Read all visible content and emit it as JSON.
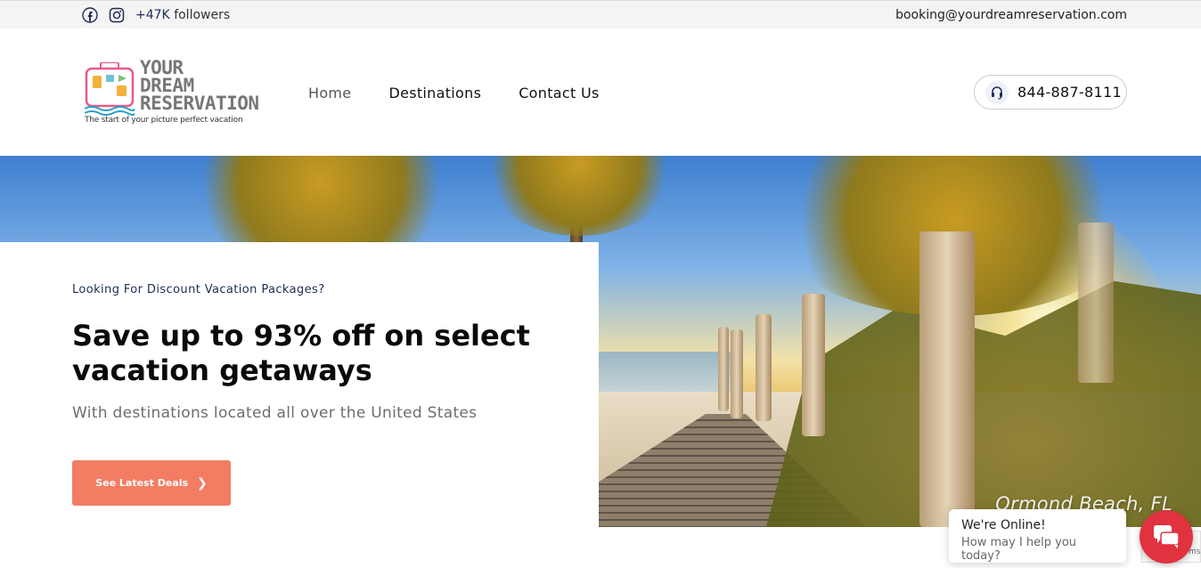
{
  "topbar": {
    "social_icons": [
      "facebook-icon",
      "instagram-icon"
    ],
    "followers_count": "+47K",
    "followers_label": "followers",
    "email": "booking@yourdreamreservation.com"
  },
  "header": {
    "logo": {
      "line1": "YOUR",
      "line2": "DREAM",
      "line3": "RESERVATION",
      "tagline": "The start of your picture perfect vacation"
    },
    "nav": [
      {
        "label": "Home",
        "active": true
      },
      {
        "label": "Destinations",
        "active": false
      },
      {
        "label": "Contact Us",
        "active": false
      }
    ],
    "phone": "844-887-8111"
  },
  "hero": {
    "eyebrow": "Looking For Discount Vacation Packages?",
    "headline": "Save up to 93% off on select vacation getaways",
    "subline": "With destinations located all over the United States",
    "cta_label": "See Latest Deals",
    "image_caption": "Ormond Beach, FL"
  },
  "chat": {
    "title": "We're Online!",
    "subtitle": "How may I help you today?"
  },
  "recaptcha_text": "ms",
  "colors": {
    "accent": "#f27d63",
    "navy": "#1e2d55",
    "chat_red": "#e0323f"
  }
}
